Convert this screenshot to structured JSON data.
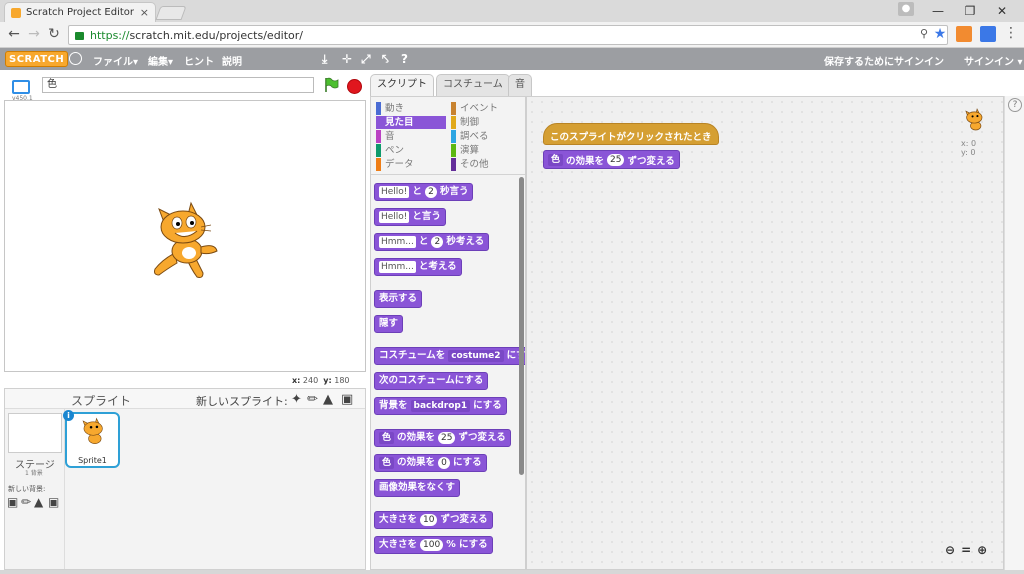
{
  "browser": {
    "tab_title": "Scratch Project Editor - I",
    "url_scheme": "https://",
    "url_rest": "scratch.mit.edu/projects/editor/",
    "tab_close": "×"
  },
  "menubar": {
    "logo": "SCRATCH",
    "file": "ファイル▾",
    "edit": "編集▾",
    "tips": "ヒント",
    "about": "説明",
    "save_signin": "保存するためにサインイン",
    "signin": "サインイン ▾"
  },
  "stage": {
    "version": "v450.1",
    "project_name": "色",
    "x_label": "x:",
    "x_value": "240",
    "y_label": "y:",
    "y_value": "180"
  },
  "sprites": {
    "title": "スプライト",
    "new_sprite": "新しいスプライト:",
    "stage_label": "ステージ",
    "stage_sub": "1 背景",
    "new_backdrop": "新しい背景:",
    "sprite1_name": "Sprite1",
    "info": "i"
  },
  "palette": {
    "tabs": [
      "スクリプト",
      "コスチューム",
      "音"
    ],
    "categories_left": [
      {
        "label": "動き",
        "color": "#4a6cd4"
      },
      {
        "label": "見た目",
        "color": "#8a55d7"
      },
      {
        "label": "音",
        "color": "#bb42c3"
      },
      {
        "label": "ペン",
        "color": "#0e9a6c"
      },
      {
        "label": "データ",
        "color": "#ee7d16"
      }
    ],
    "categories_right": [
      {
        "label": "イベント",
        "color": "#c88330"
      },
      {
        "label": "制御",
        "color": "#e1a91a"
      },
      {
        "label": "調べる",
        "color": "#2ca5e2"
      },
      {
        "label": "演算",
        "color": "#5cb712"
      },
      {
        "label": "その他",
        "color": "#632d99"
      }
    ],
    "blocks": {
      "say_for_slot": "Hello!",
      "say_for_mid": "と",
      "say_for_num": "2",
      "say_for_end": "秒言う",
      "say_slot": "Hello!",
      "say_end": "と言う",
      "think_for_slot": "Hmm...",
      "think_for_mid": "と",
      "think_for_num": "2",
      "think_for_end": "秒考える",
      "think_slot": "Hmm...",
      "think_end": "と考える",
      "show": "表示する",
      "hide": "隠す",
      "costume_start": "コスチュームを",
      "costume_dd": "costume2",
      "costume_end": "にす",
      "next_costume": "次のコスチュームにする",
      "backdrop_start": "背景を",
      "backdrop_dd": "backdrop1",
      "backdrop_end": "にする",
      "effect_change_dd": "色",
      "effect_change_mid": "の効果を",
      "effect_change_num": "25",
      "effect_change_end": "ずつ変える",
      "effect_set_dd": "色",
      "effect_set_mid": "の効果を",
      "effect_set_num": "0",
      "effect_set_end": "にする",
      "clear_effects": "画像効果をなくす",
      "size_change_start": "大きさを",
      "size_change_num": "10",
      "size_change_end": "ずつ変える",
      "size_set_start": "大きさを",
      "size_set_num": "100",
      "size_set_end": "% にする"
    }
  },
  "scripts": {
    "hat_block": "このスプライトがクリックされたとき",
    "effect_dd": "色",
    "effect_mid": "の効果を",
    "effect_num": "25",
    "effect_end": "ずつ変える",
    "sprite_x": "x: 0",
    "sprite_y": "y: 0"
  },
  "colors": {
    "looks": "#8a55d7",
    "events": "#d59f33",
    "menubar": "#9c9ea2",
    "accent_blue": "#2ea0d6"
  }
}
